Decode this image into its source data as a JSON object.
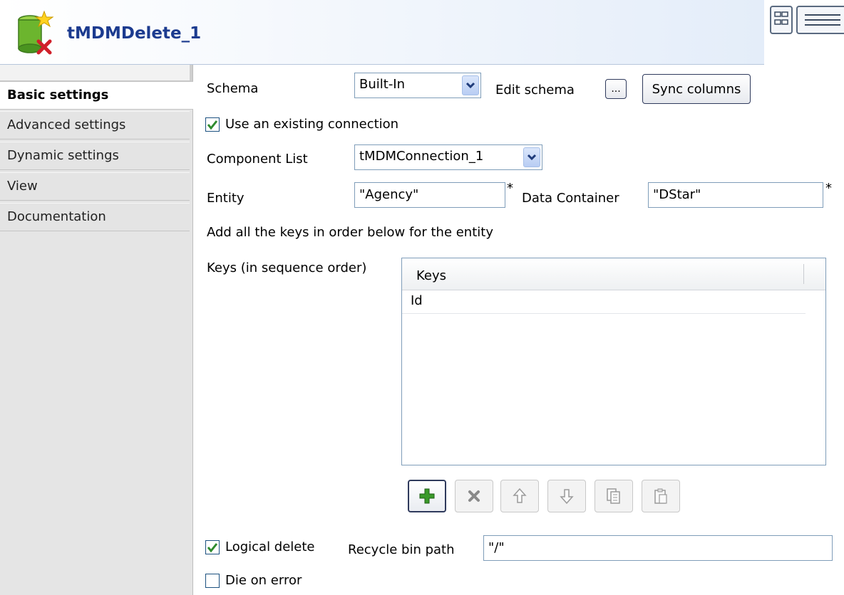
{
  "header": {
    "title": "tMDMDelete_1",
    "icon": "tmdmdelete-component-icon",
    "view_buttons": [
      "grid-view-icon",
      "list-view-icon"
    ]
  },
  "tabs": [
    {
      "label": "Basic settings",
      "active": true
    },
    {
      "label": "Advanced settings",
      "active": false
    },
    {
      "label": "Dynamic settings",
      "active": false
    },
    {
      "label": "View",
      "active": false
    },
    {
      "label": "Documentation",
      "active": false
    }
  ],
  "form": {
    "schema_label": "Schema",
    "schema_value": "Built-In",
    "edit_schema_label": "Edit schema",
    "edit_schema_button": "...",
    "sync_columns_button": "Sync columns",
    "use_existing_connection": {
      "label": "Use an existing connection",
      "checked": true
    },
    "component_list_label": "Component List",
    "component_list_value": "tMDMConnection_1",
    "entity_label": "Entity",
    "entity_value": "\"Agency\"",
    "data_container_label": "Data Container",
    "data_container_value": "\"DStar\"",
    "required_marker": "*",
    "keys_hint": "Add all the keys in order below for the entity",
    "keys_label": "Keys (in sequence order)",
    "keys_table": {
      "column": "Keys",
      "rows": [
        "Id"
      ]
    },
    "table_buttons": [
      "add-icon",
      "remove-icon",
      "move-up-icon",
      "move-down-icon",
      "copy-icon",
      "paste-icon"
    ],
    "logical_delete": {
      "label": "Logical delete",
      "checked": true
    },
    "recycle_bin_label": "Recycle bin path",
    "recycle_bin_value": "\"/\"",
    "die_on_error": {
      "label": "Die on error",
      "checked": false
    }
  },
  "colors": {
    "title": "#1c3b8f",
    "checkmark": "#2e8b2e",
    "add_icon": "#3a9a2a"
  }
}
